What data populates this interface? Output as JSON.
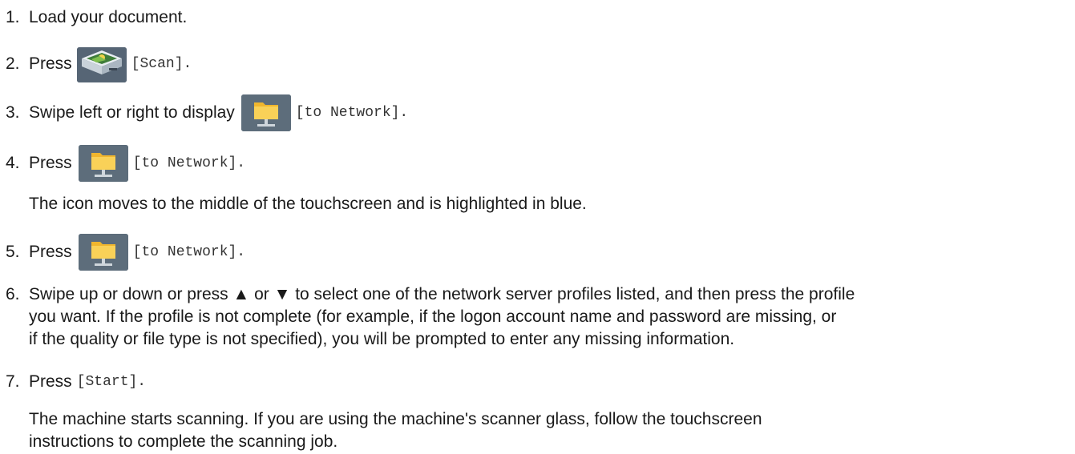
{
  "steps": [
    {
      "number": "1.",
      "text": "Load your document."
    },
    {
      "number": "2.",
      "prefix": "Press",
      "icon": "scanner-icon",
      "code": "[Scan]."
    },
    {
      "number": "3.",
      "prefix": "Swipe left or right to display",
      "icon": "network-folder-icon",
      "code": "[to Network]."
    },
    {
      "number": "4.",
      "prefix": "Press",
      "icon": "network-folder-icon",
      "code": "[to Network].",
      "note": "The icon moves to the middle of the touchscreen and is highlighted in blue."
    },
    {
      "number": "5.",
      "prefix": "Press",
      "icon": "network-folder-icon",
      "code": "[to Network]."
    },
    {
      "number": "6.",
      "lines": [
        "Swipe up or down or press ▲ or ▼ to select one of the network server profiles listed, and then press the profile",
        "you want. If the profile is not complete (for example, if the logon account name and password are missing, or",
        "if the quality or file type is not specified), you will be prompted to enter any missing information."
      ]
    },
    {
      "number": "7.",
      "prefix": "Press",
      "code": "[Start].",
      "note_lines": [
        "The machine starts scanning. If you are using the machine's scanner glass, follow the touchscreen",
        "instructions to complete the scanning job."
      ]
    }
  ],
  "colors": {
    "text": "#1a1a1a",
    "code_text": "#333333",
    "icon_tile": "#5c6b7a",
    "folder_yellow": "#f7c84a"
  }
}
